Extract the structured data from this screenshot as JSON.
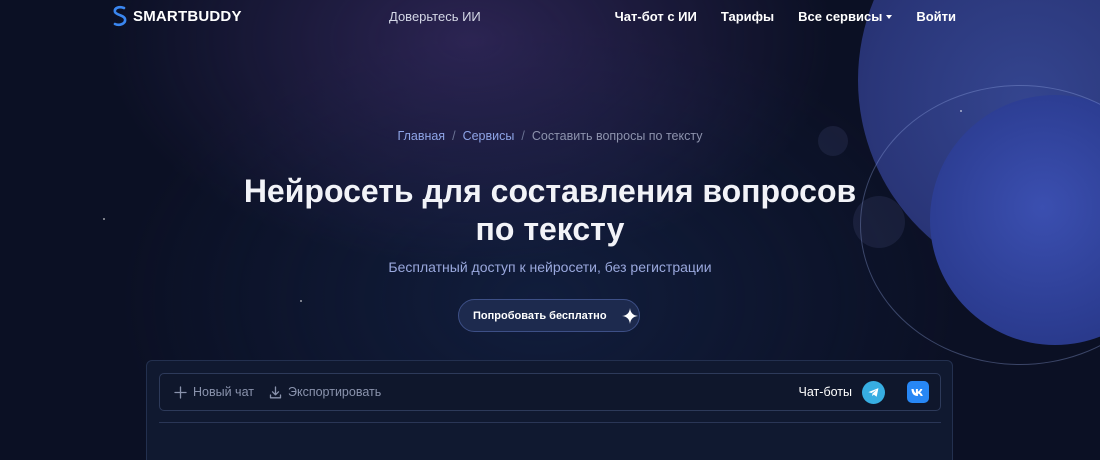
{
  "brand": {
    "name": "SMARTBUDDY"
  },
  "header": {
    "tagline": "Доверьтесь ИИ",
    "nav": [
      {
        "label": "Чат-бот с ИИ"
      },
      {
        "label": "Тарифы"
      },
      {
        "label": "Все сервисы"
      },
      {
        "label": "Войти"
      }
    ]
  },
  "breadcrumb": {
    "items": [
      "Главная",
      "Сервисы",
      "Составить вопросы по тексту"
    ],
    "separator": "/"
  },
  "hero": {
    "title_line1": "Нейросеть для составления вопросов",
    "title_line2": "по тексту",
    "subtitle": "Бесплатный доступ к нейросети, без регистрации",
    "cta_label": "Попробовать бесплатно"
  },
  "chat_panel": {
    "new_chat_label": "Новый чат",
    "export_label": "Экспортировать",
    "chatbots_label": "Чат-боты"
  },
  "icons": {
    "logo": "smartbuddy-logo-icon",
    "cta": "sparkle-icon",
    "new_chat": "plus-icon",
    "export": "download-icon",
    "telegram": "telegram-icon",
    "vk": "vk-icon",
    "dropdown": "chevron-down-icon"
  },
  "colors": {
    "background": "#0b1024",
    "accent_link": "#8ea4e6",
    "subtitle": "#9aa8dd",
    "telegram": "#37aee2",
    "vk": "#2787f5",
    "planet": "#2c3d92"
  }
}
